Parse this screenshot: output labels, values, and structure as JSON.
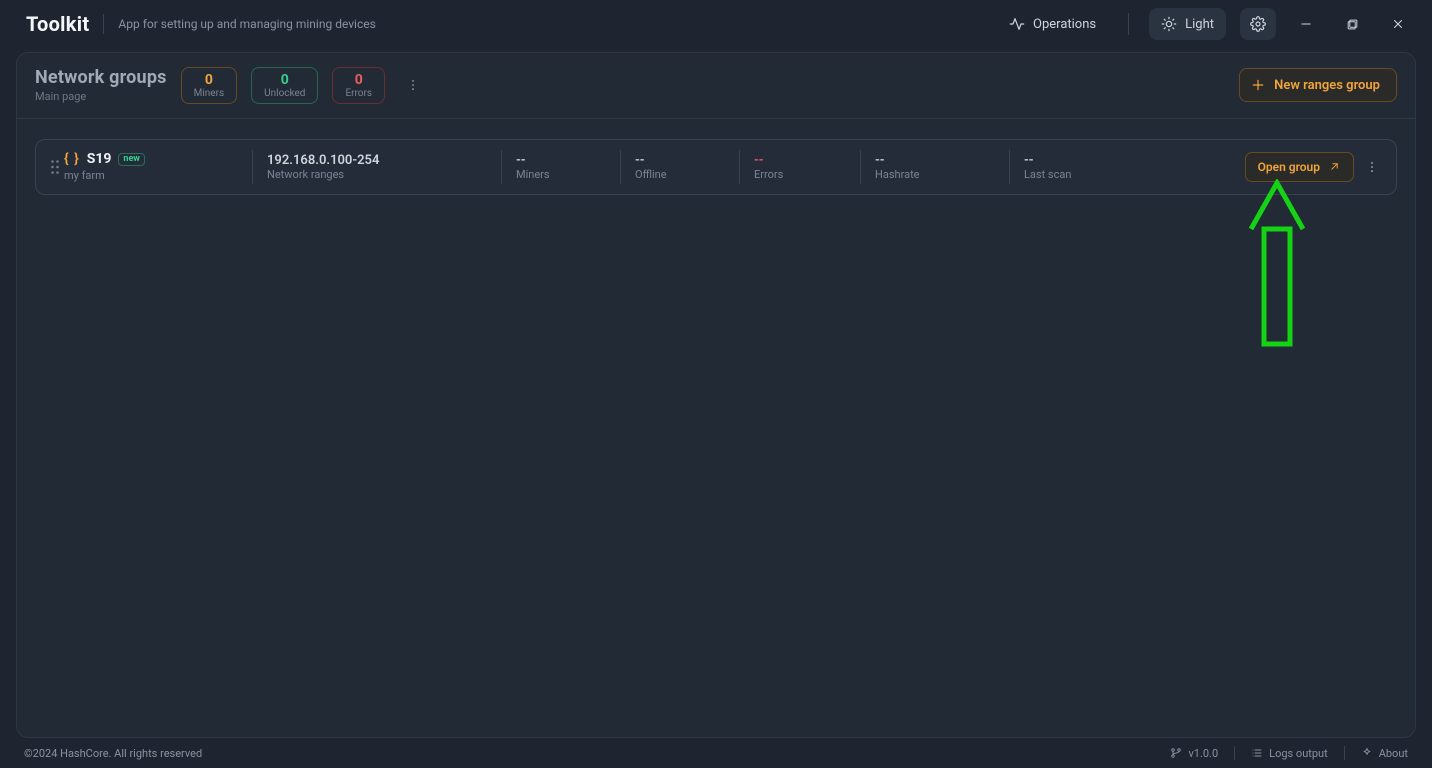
{
  "app": {
    "name": "Toolkit",
    "description": "App for setting up and managing mining devices"
  },
  "titlebar": {
    "operations": "Operations",
    "theme": "Light"
  },
  "page": {
    "title": "Network groups",
    "subtitle": "Main page",
    "new_button": "New ranges group"
  },
  "stats": {
    "miners": {
      "value": "0",
      "label": "Miners"
    },
    "unlocked": {
      "value": "0",
      "label": "Unlocked"
    },
    "errors": {
      "value": "0",
      "label": "Errors"
    }
  },
  "group": {
    "name": "S19",
    "tag": "new",
    "subtitle": "my farm",
    "ranges_value": "192.168.0.100-254",
    "ranges_label": "Network ranges",
    "miners_value": "--",
    "miners_label": "Miners",
    "offline_value": "--",
    "offline_label": "Offline",
    "errors_value": "--",
    "errors_label": "Errors",
    "hashrate_value": "--",
    "hashrate_label": "Hashrate",
    "lastscan_value": "--",
    "lastscan_label": "Last scan",
    "open_label": "Open group"
  },
  "status": {
    "copyright": "©2024 HashCore. All rights reserved",
    "version": "v1.0.0",
    "logs": "Logs output",
    "about": "About"
  },
  "colors": {
    "accent": "#f2a43b",
    "green": "#34cf8d",
    "red": "#e95d60",
    "bg": "#1e2530"
  }
}
